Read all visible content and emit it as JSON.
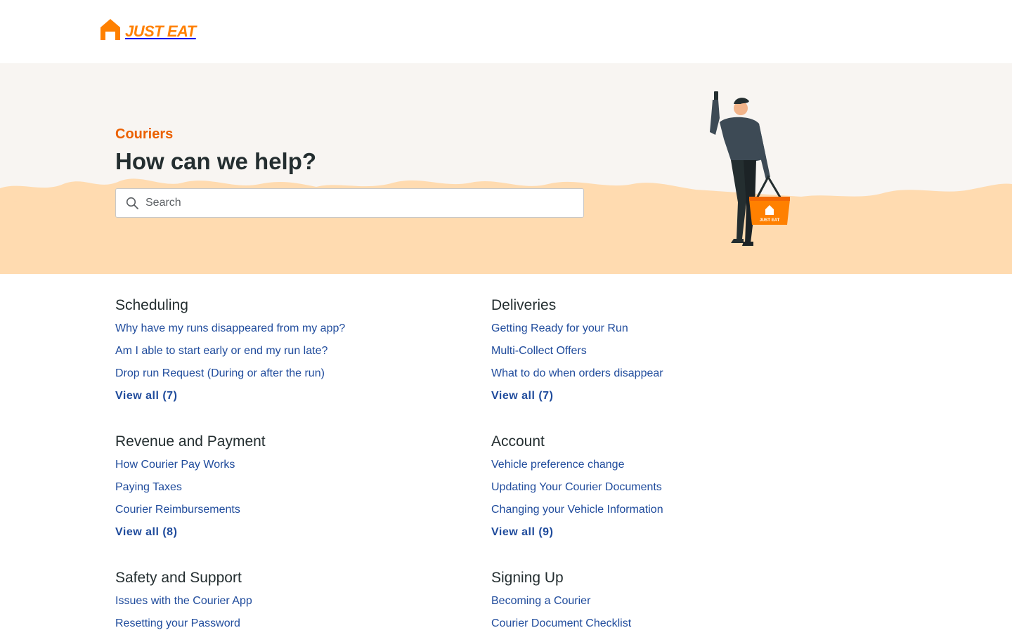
{
  "brand": {
    "name": "JUST EAT",
    "color": "#ff8000"
  },
  "hero": {
    "kicker": "Couriers",
    "title": "How can we help?",
    "search_placeholder": "Search",
    "accent_color": "#eb6100"
  },
  "categories": [
    {
      "title": "Scheduling",
      "links": [
        "Why have my runs disappeared from my app?",
        "Am I able to start early or end my run late?",
        "Drop run Request (During or after the run)"
      ],
      "view_all": "View all (7)"
    },
    {
      "title": "Deliveries",
      "links": [
        "Getting Ready for your Run",
        "Multi-Collect Offers",
        "What to do when orders disappear"
      ],
      "view_all": "View all (7)"
    },
    {
      "title": "Revenue and Payment",
      "links": [
        "How Courier Pay Works",
        "Paying Taxes",
        "Courier Reimbursements"
      ],
      "view_all": "View all (8)"
    },
    {
      "title": "Account",
      "links": [
        "Vehicle preference change",
        "Updating Your Courier Documents",
        "Changing your Vehicle Information"
      ],
      "view_all": "View all (9)"
    },
    {
      "title": "Safety and Support",
      "links": [
        "Issues with the Courier App",
        "Resetting your Password"
      ],
      "view_all": ""
    },
    {
      "title": "Signing Up",
      "links": [
        "Becoming a Courier",
        "Courier Document Checklist"
      ],
      "view_all": ""
    }
  ],
  "colors": {
    "link": "#1f4b9c",
    "hero_bg": "#f8f5f2",
    "wave": "#ffdbb0"
  }
}
